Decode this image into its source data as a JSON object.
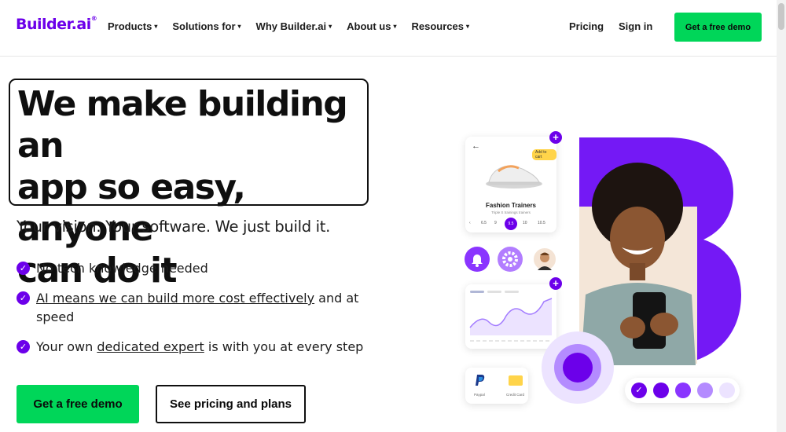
{
  "header": {
    "logo": "Builder.ai",
    "logo_mark": "®",
    "nav": [
      {
        "label": "Products"
      },
      {
        "label": "Solutions for"
      },
      {
        "label": "Why Builder.ai"
      },
      {
        "label": "About us"
      },
      {
        "label": "Resources"
      }
    ],
    "caret": "▾",
    "pricing": "Pricing",
    "signin": "Sign in",
    "demo_button": "Get a free demo"
  },
  "hero": {
    "headline_line1": "We make building an",
    "headline_line2": "app so easy, anyone",
    "headline_line3": "can do it",
    "subtitle": "Your vision. Your software. We just build it.",
    "features": [
      {
        "pre": "",
        "link": "",
        "post": "No tech knowledge needed"
      },
      {
        "pre": "",
        "link": "AI means we can build more cost effectively",
        "post": " and at speed"
      },
      {
        "pre": "Your own ",
        "link": "dedicated expert",
        "post": " is with you at every step"
      }
    ],
    "check_glyph": "✓",
    "cta_primary": "Get a free demo",
    "cta_secondary": "See pricing and plans"
  },
  "illustration": {
    "product_name": "Fashion Trainers",
    "product_sub": "Triple S trainings trainers",
    "add_badge": "Add to cart",
    "back_glyph": "←",
    "sizes": [
      "6.5",
      "9",
      "9.5",
      "10",
      "10.5"
    ],
    "selected_size": "9.5",
    "plus_glyph": "+",
    "pay_paypal": "Paypal",
    "pay_card": "Credit Card",
    "dot_colors": [
      "#6c00ea",
      "#6c00ea",
      "#8a35ff",
      "#b48bff",
      "#ece3ff"
    ],
    "dot_check": "✓",
    "accent": "#6c00ea",
    "green": "#00d659"
  }
}
